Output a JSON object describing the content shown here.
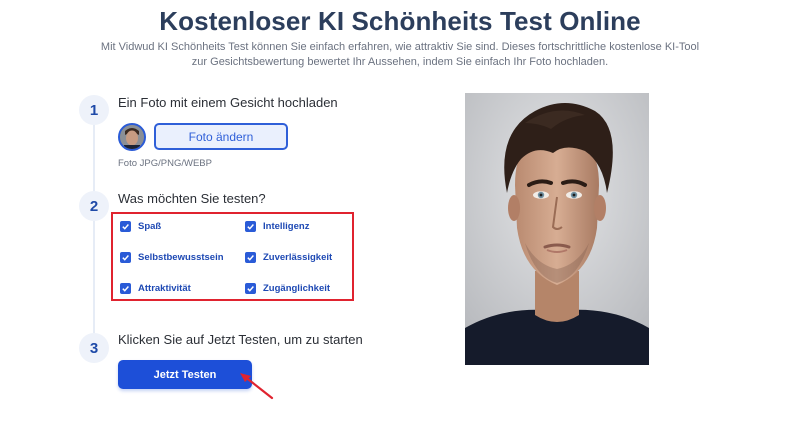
{
  "header": {
    "title": "Kostenloser KI Schönheits Test Online",
    "subtitle": "Mit Vidwud KI Schönheits Test können Sie einfach erfahren, wie attraktiv Sie sind. Dieses fortschrittliche kostenlose KI-Tool zur Gesichtsbewertung bewertet Ihr Aussehen, indem Sie einfach Ihr Foto hochladen."
  },
  "steps": [
    {
      "number": "1",
      "title": "Ein Foto mit einem Gesicht hochladen"
    },
    {
      "number": "2",
      "title": "Was möchten Sie testen?"
    },
    {
      "number": "3",
      "title": "Klicken Sie auf Jetzt Testen, um zu starten"
    }
  ],
  "upload": {
    "change_label": "Foto ändern",
    "formats_hint": "Foto JPG/PNG/WEBP"
  },
  "options": [
    {
      "label": "Spaß",
      "checked": true
    },
    {
      "label": "Intelligenz",
      "checked": true
    },
    {
      "label": "Selbstbewusstsein",
      "checked": true
    },
    {
      "label": "Zuverlässigkeit",
      "checked": true
    },
    {
      "label": "Attraktivität",
      "checked": true
    },
    {
      "label": "Zugänglichkeit",
      "checked": true
    }
  ],
  "actions": {
    "start_label": "Jetzt Testen"
  },
  "colors": {
    "primary": "#1d4fd8",
    "title": "#2c3e5c",
    "highlight": "#e0232f",
    "step_bg": "#eef2fa"
  }
}
